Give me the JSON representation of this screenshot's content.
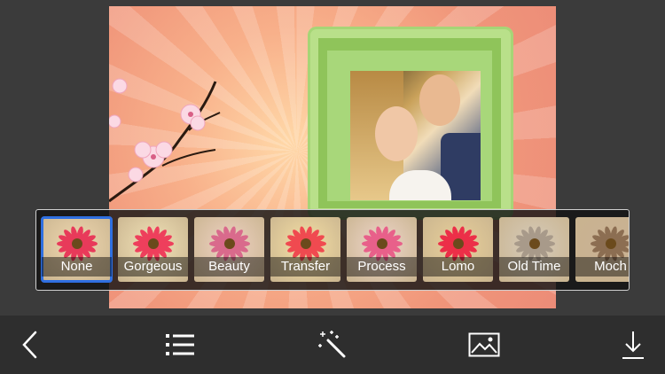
{
  "filters": [
    {
      "label": "None",
      "tint": "#f0d8b0",
      "petal": "#e83a5a",
      "selected": true
    },
    {
      "label": "Gorgeous",
      "tint": "#f2e3b8",
      "petal": "#ee3f5c",
      "selected": false
    },
    {
      "label": "Beauty",
      "tint": "#efd2c4",
      "petal": "#d96a8c",
      "selected": false
    },
    {
      "label": "Transfer",
      "tint": "#f6e0a4",
      "petal": "#f04a50",
      "selected": false
    },
    {
      "label": "Process",
      "tint": "#efd6cc",
      "petal": "#e8608a",
      "selected": false
    },
    {
      "label": "Lomo",
      "tint": "#e9d09a",
      "petal": "#ec2f48",
      "selected": false
    },
    {
      "label": "Old Time",
      "tint": "#d6cbbb",
      "petal": "#a89a8a",
      "selected": false
    },
    {
      "label": "Moch",
      "tint": "#c9b094",
      "petal": "#8c6e52",
      "selected": false
    }
  ],
  "toolbar": {
    "items": [
      "back-arrow-icon",
      "list-icon",
      "magic-wand-icon",
      "image-icon",
      "download-icon"
    ]
  },
  "colors": {
    "selected_border": "#2f6fe0",
    "frame_green": "#b9e08a",
    "toolbar_bg": "#2e2e2e"
  }
}
